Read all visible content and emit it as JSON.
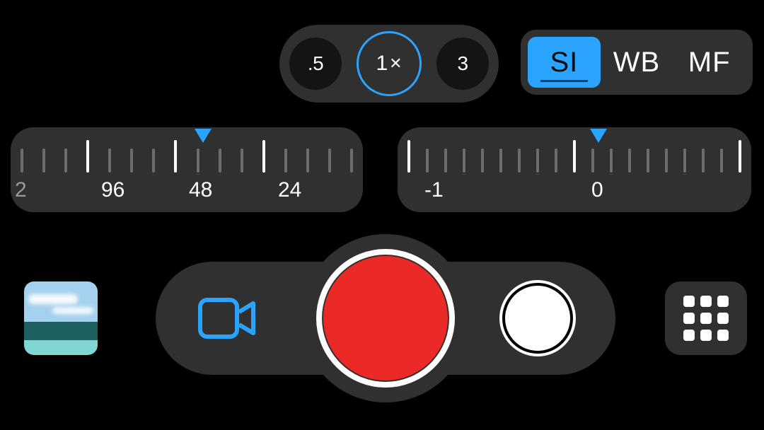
{
  "zoom": {
    "options": [
      ".5",
      "1",
      "3"
    ],
    "active_index": 1,
    "active_suffix": "✕"
  },
  "modes": {
    "options": [
      "SI",
      "WB",
      "MF"
    ],
    "active_index": 0
  },
  "dial_left": {
    "labels": [
      "2",
      "96",
      "48",
      "24"
    ],
    "pointer_label": "48"
  },
  "dial_right": {
    "labels": [
      "-1",
      "0"
    ],
    "pointer_label": "0"
  },
  "icons": {
    "video": "video-camera",
    "grid": "grid"
  },
  "colors": {
    "accent": "#2aa4ff",
    "record": "#eb2a28",
    "panel": "#303030"
  }
}
